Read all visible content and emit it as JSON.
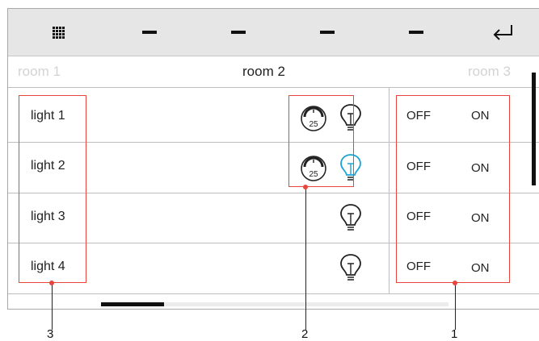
{
  "topbar": {
    "menu_icon": "grid-menu-icon",
    "tab_icon": "dash-icon",
    "back_icon": "return-arrow-icon"
  },
  "rooms": [
    {
      "label": "room 1",
      "state": "inactive"
    },
    {
      "label": "room 2",
      "state": "active"
    },
    {
      "label": "room 3",
      "state": "inactive"
    }
  ],
  "lights": [
    {
      "label": "light 1",
      "dimmer_value": "25",
      "has_dimmer": true,
      "bulb_color": "#222222",
      "off_label": "OFF",
      "on_label": "ON"
    },
    {
      "label": "light 2",
      "dimmer_value": "25",
      "has_dimmer": true,
      "bulb_color": "#1ba3d6",
      "off_label": "OFF",
      "on_label": "ON"
    },
    {
      "label": "light 3",
      "has_dimmer": false,
      "bulb_color": "#222222",
      "off_label": "OFF",
      "on_label": "ON"
    },
    {
      "label": "light 4",
      "has_dimmer": false,
      "bulb_color": "#222222",
      "off_label": "OFF",
      "on_label": "ON"
    }
  ],
  "callouts": [
    "1",
    "2",
    "3"
  ],
  "colors": {
    "callout": "#e8453c",
    "active_bulb": "#1ba3d6",
    "topbar_bg": "#e6e6e6"
  }
}
